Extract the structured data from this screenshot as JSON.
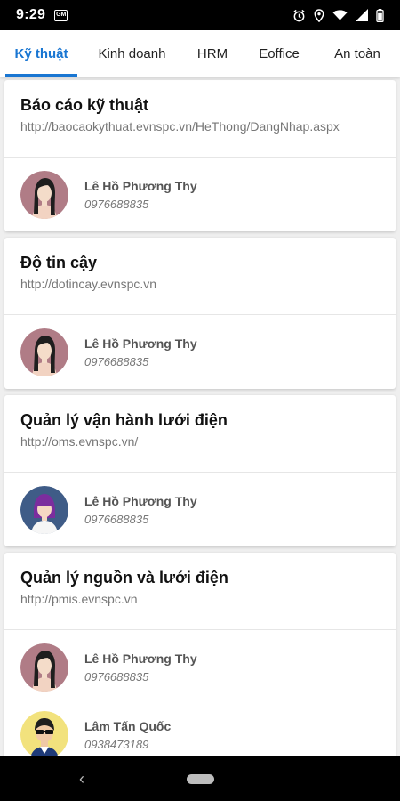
{
  "status": {
    "time": "9:29",
    "notif_label": "GM",
    "icons": [
      "alarm-icon",
      "location-icon",
      "wifi-icon",
      "signal-icon",
      "battery-icon"
    ]
  },
  "tabs": [
    {
      "label": "Kỹ thuật",
      "active": true
    },
    {
      "label": "Kinh doanh",
      "active": false
    },
    {
      "label": "HRM",
      "active": false
    },
    {
      "label": "Eoffice",
      "active": false
    },
    {
      "label": "An toàn",
      "active": false
    }
  ],
  "colors": {
    "accent": "#1976d2"
  },
  "cards": [
    {
      "title": "Báo cáo kỹ thuật",
      "url": "http://baocaokythuat.evnspc.vn/HeThong/DangNhap.aspx",
      "contacts": [
        {
          "name": "Lê Hồ Phương Thy",
          "phone": "0976688835",
          "avatar": "woman-avatar"
        }
      ]
    },
    {
      "title": "Độ tin cậy",
      "url": "http://dotincay.evnspc.vn",
      "contacts": [
        {
          "name": "Lê Hồ Phương Thy",
          "phone": "0976688835",
          "avatar": "woman-avatar"
        }
      ]
    },
    {
      "title": "Quản lý vận hành lưới điện",
      "url": "http://oms.evnspc.vn/",
      "contacts": [
        {
          "name": "Lê Hồ Phương Thy",
          "phone": "0976688835",
          "avatar": "woman-purple-avatar"
        }
      ]
    },
    {
      "title": "Quản lý nguồn và lưới điện",
      "url": "http://pmis.evnspc.vn",
      "contacts": [
        {
          "name": "Lê Hồ Phương Thy",
          "phone": "0976688835",
          "avatar": "woman-avatar"
        },
        {
          "name": "Lâm Tấn Quốc",
          "phone": "0938473189",
          "avatar": "man-sunglasses-avatar"
        }
      ]
    }
  ],
  "nav": {
    "back_glyph": "‹"
  }
}
